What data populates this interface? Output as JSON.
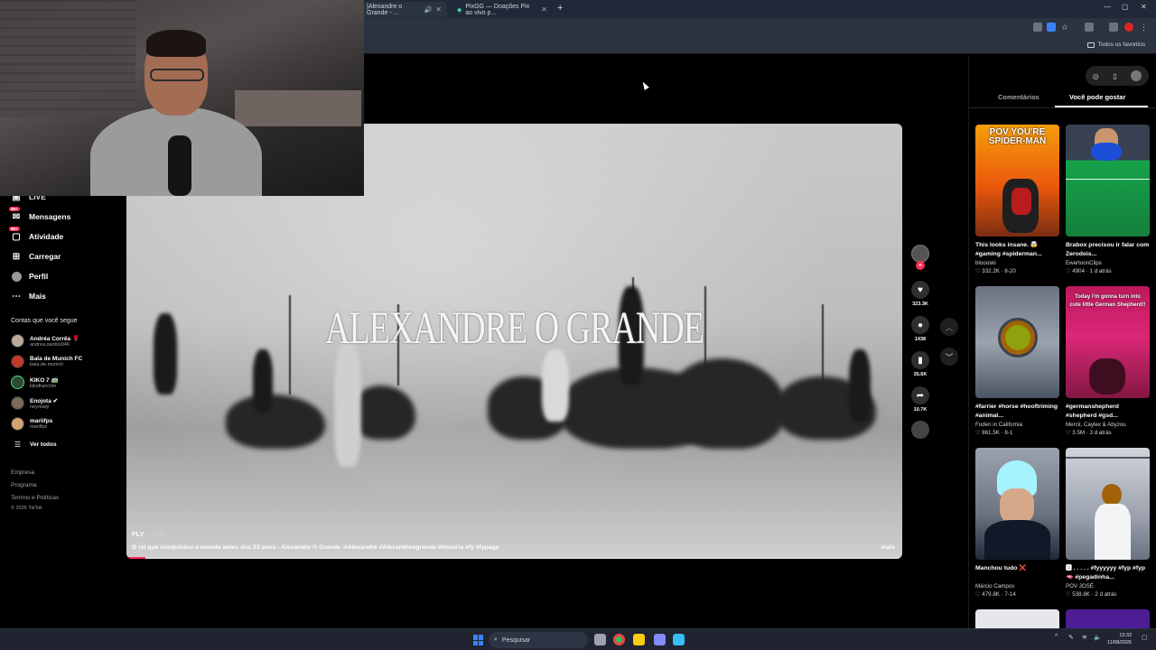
{
  "browser": {
    "tabs": [
      {
        "label": "|Alexandre o Grande - ...",
        "active": true
      },
      {
        "label": "PixGG — Doações Pix ao vivo p...",
        "active": false
      }
    ],
    "bookmarks_label": "Todos os favoritos"
  },
  "leftnav": {
    "items": [
      {
        "label": "LIVE",
        "icon": "live-icon",
        "badge": ""
      },
      {
        "label": "Mensagens",
        "icon": "messages-icon",
        "badge": "99+"
      },
      {
        "label": "Atividade",
        "icon": "activity-icon",
        "badge": "99+"
      },
      {
        "label": "Carregar",
        "icon": "upload-icon",
        "badge": ""
      },
      {
        "label": "Perfil",
        "icon": "profile-icon",
        "badge": ""
      },
      {
        "label": "Mais",
        "icon": "more-icon",
        "badge": ""
      }
    ],
    "following_heading": "Contas que você segue",
    "following": [
      {
        "name": "Andréa Corrêa 🌹",
        "handle": "andrea.santos946"
      },
      {
        "name": "Bala de Munich FC",
        "handle": "bala.de.munich"
      },
      {
        "name": "KIKO 7 🚎",
        "handle": "kikofranchin"
      },
      {
        "name": "Enojota ✔",
        "handle": "neymarjr"
      },
      {
        "name": "mariifps",
        "handle": "mariifps"
      }
    ],
    "see_all": "Ver todos",
    "footer": [
      "Empresa",
      "Programa",
      "Termos e Políticas",
      "© 2026 TikTok"
    ]
  },
  "video": {
    "overlay_title": "ALEXANDRE O GRANDE",
    "author": "FLY",
    "date": " · 7-12",
    "caption": "O rei que conquistou o mundo antes dos 33 anos - Alexandre O Grande -#Alexandre #Alexandreogrande #historia #fy #fypage",
    "more": "mais",
    "progress": 0.025
  },
  "actions": {
    "likes": "323.3K",
    "comments": "1438",
    "saves": "35.6K",
    "shares": "10.7K"
  },
  "rightpanel": {
    "tabs": [
      "Comentários",
      "Você pode gostar"
    ],
    "active_tab": "Você pode gostar",
    "cards": [
      {
        "title": "This looks insane. 🤯 #gaming #spiderman...",
        "author": "bloooski",
        "likes": "332.2K",
        "date": "6-20",
        "thumb_text": "POV YOU'RE SPIDER-MAN"
      },
      {
        "title": "Brabox precisou ir falar com Zerodois...",
        "author": "EwertoonClips",
        "likes": "4904",
        "date": "1 d atrás",
        "thumb_text": ""
      },
      {
        "title": "#farrier #horse #hooftriming #animal...",
        "author": "Foden in California",
        "likes": "861.5K",
        "date": "8-1",
        "thumb_text": ""
      },
      {
        "title": "#germanshepherd #shepherd #gsd...",
        "author": "Mercii, Caylex & Abyzou",
        "likes": "3.5M",
        "date": "3 d atrás",
        "thumb_text": "Today i'm gonna turn into cute little German Shepherd!!"
      },
      {
        "title": "Manchou tudo ❌",
        "author": "Márcio Campos",
        "likes": "479.8K",
        "date": "7-14",
        "thumb_text": ""
      },
      {
        "title": "🅰 . . . . . #fyyyyyy #fyp #fyp🫦 #pegadinha...",
        "author": "POV JOSÉ",
        "likes": "538.8K",
        "date": "2 d atrás",
        "thumb_text": ""
      }
    ]
  },
  "taskbar": {
    "search_label": "Pesquisar",
    "time": "13:32",
    "date": "11/08/2026"
  },
  "colors": {
    "accent": "#fe2c55",
    "taskbar": "#1f2430",
    "chrome": "#2b3340"
  }
}
